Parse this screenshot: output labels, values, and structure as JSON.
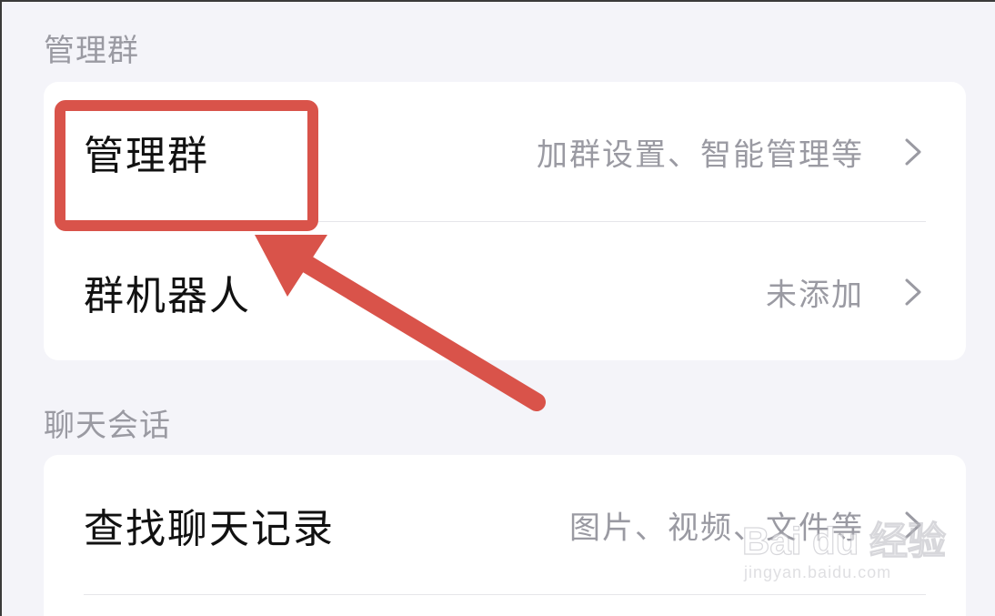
{
  "sections": [
    {
      "title": "管理群",
      "rows": [
        {
          "label": "管理群",
          "value": "加群设置、智能管理等"
        },
        {
          "label": "群机器人",
          "value": "未添加"
        }
      ]
    },
    {
      "title": "聊天会话",
      "rows": [
        {
          "label": "查找聊天记录",
          "value": "图片、视频、文件等"
        }
      ]
    }
  ],
  "annotation": {
    "color": "#d9534a",
    "highlight_target": "管理群"
  },
  "watermark": {
    "logo": "Bai du 经验",
    "url": "jingyan.baidu.com"
  },
  "icons": {
    "row_chevron": "chevron-right-icon",
    "watermark": "baidu-paw-icon"
  }
}
